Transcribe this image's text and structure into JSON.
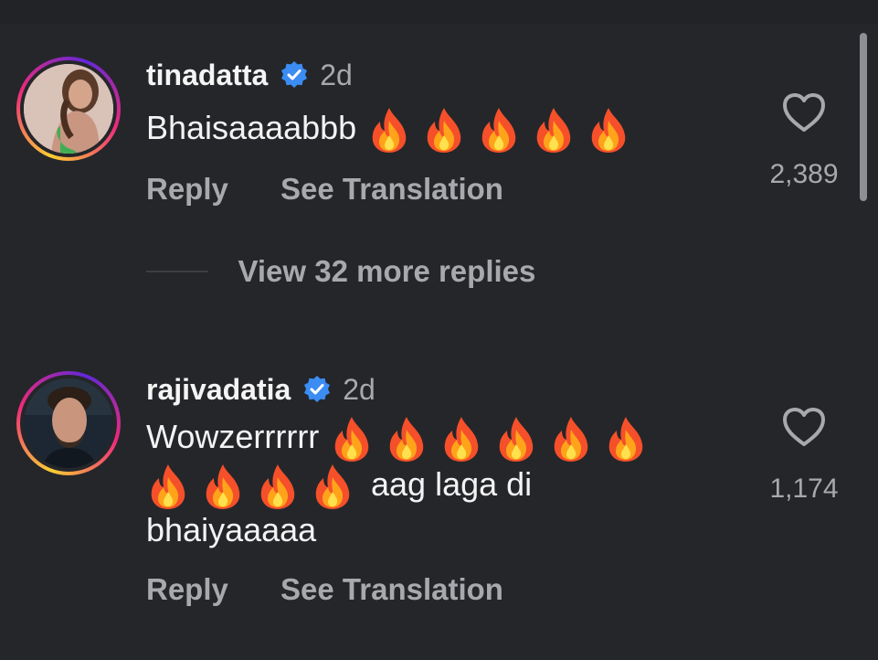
{
  "comments": [
    {
      "username": "tinadatta",
      "time": "2d",
      "text_lines": [
        "Bhaisaaaabbb"
      ],
      "fire_count": 5,
      "reply_label": "Reply",
      "translation_label": "See Translation",
      "like_count": "2,389",
      "view_replies": "View 32 more replies"
    },
    {
      "username": "rajivadatia",
      "time": "2d",
      "line1": "Wowzerrrrrr",
      "line1_fires": 6,
      "line2_fires": 4,
      "line2_text": "aag laga di",
      "line3": "bhaiyaaaaa",
      "reply_label": "Reply",
      "translation_label": "See Translation",
      "like_count": "1,174"
    }
  ],
  "colors": {
    "background": "#25262a",
    "verified": "#3b8cf3",
    "muted": "#a8a9ad"
  }
}
